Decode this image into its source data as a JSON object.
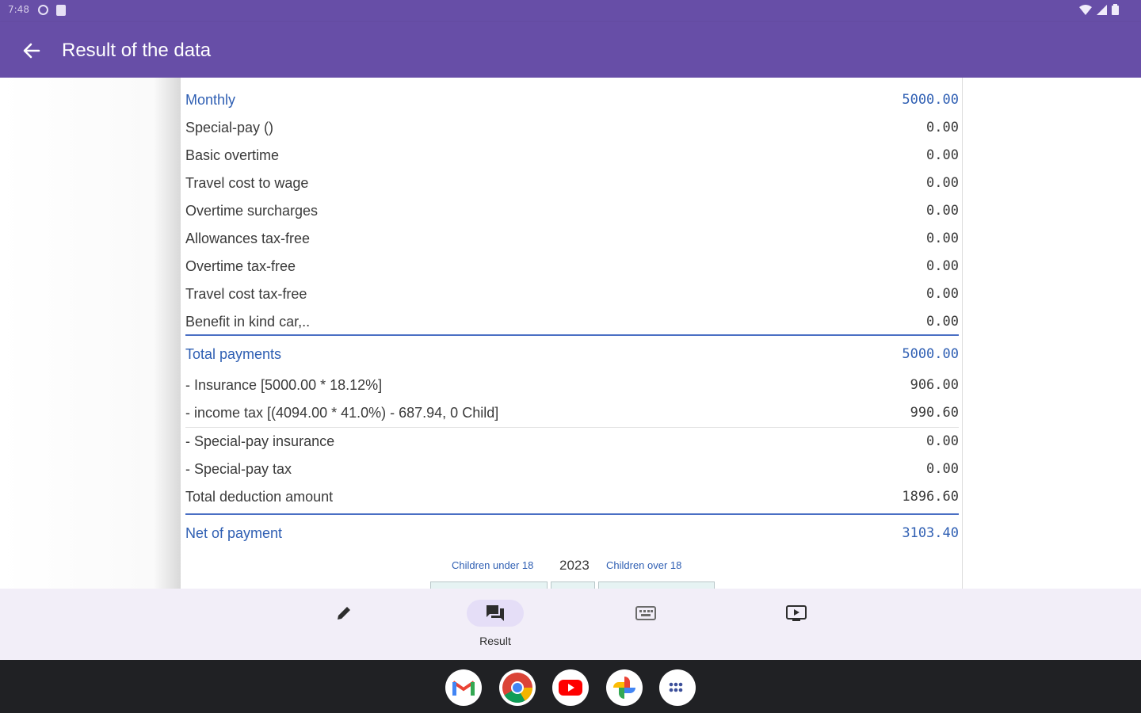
{
  "status_bar": {
    "time": "7:48",
    "left_icons": [
      "at-sign-icon",
      "sd-card-icon"
    ],
    "right_icons": [
      "wifi-icon",
      "cell-signal-icon",
      "battery-icon"
    ]
  },
  "app_bar": {
    "title": "Result of the data",
    "back_icon": "arrow-left-icon",
    "color": "#674ea7"
  },
  "result": {
    "header": {
      "label": "Monthly",
      "value": "5000.00"
    },
    "payments": [
      {
        "label": "Special-pay ()",
        "value": "0.00"
      },
      {
        "label": "Basic overtime",
        "value": "0.00"
      },
      {
        "label": "Travel cost to wage",
        "value": "0.00"
      },
      {
        "label": "Overtime surcharges",
        "value": "0.00"
      },
      {
        "label": "Allowances tax-free",
        "value": "0.00"
      },
      {
        "label": "Overtime tax-free",
        "value": "0.00"
      },
      {
        "label": "Travel cost tax-free",
        "value": "0.00"
      },
      {
        "label": "Benefit in kind car,..",
        "value": "0.00"
      }
    ],
    "total_payments": {
      "label": "Total payments",
      "value": "5000.00"
    },
    "deductions_main": [
      {
        "label": "- Insurance [5000.00 * 18.12%]",
        "value": "906.00"
      },
      {
        "label": "- income tax [(4094.00 * 41.0%) - 687.94, 0 Child]",
        "value": "990.60"
      }
    ],
    "deductions_special": [
      {
        "label": "- Special-pay insurance",
        "value": "0.00"
      },
      {
        "label": "- Special-pay tax",
        "value": "0.00"
      }
    ],
    "total_deduction": {
      "label": "Total deduction amount",
      "value": "1896.60"
    },
    "net": {
      "label": "Net of payment",
      "value": "3103.40"
    },
    "children": {
      "under_label": "Children under 18",
      "year": "2023",
      "over_label": "Children over 18"
    },
    "accent_color": "#2f5fb3"
  },
  "bottom_nav": {
    "items": [
      {
        "icon": "pencil-icon",
        "label": "",
        "active": false
      },
      {
        "icon": "chat-bubbles-icon",
        "label": "Result",
        "active": true
      },
      {
        "icon": "keyboard-icon",
        "label": "",
        "active": false
      },
      {
        "icon": "play-screen-icon",
        "label": "",
        "active": false
      }
    ]
  },
  "dock": {
    "apps": [
      "gmail-icon",
      "chrome-icon",
      "youtube-icon",
      "photos-icon",
      "app-drawer-icon"
    ]
  }
}
